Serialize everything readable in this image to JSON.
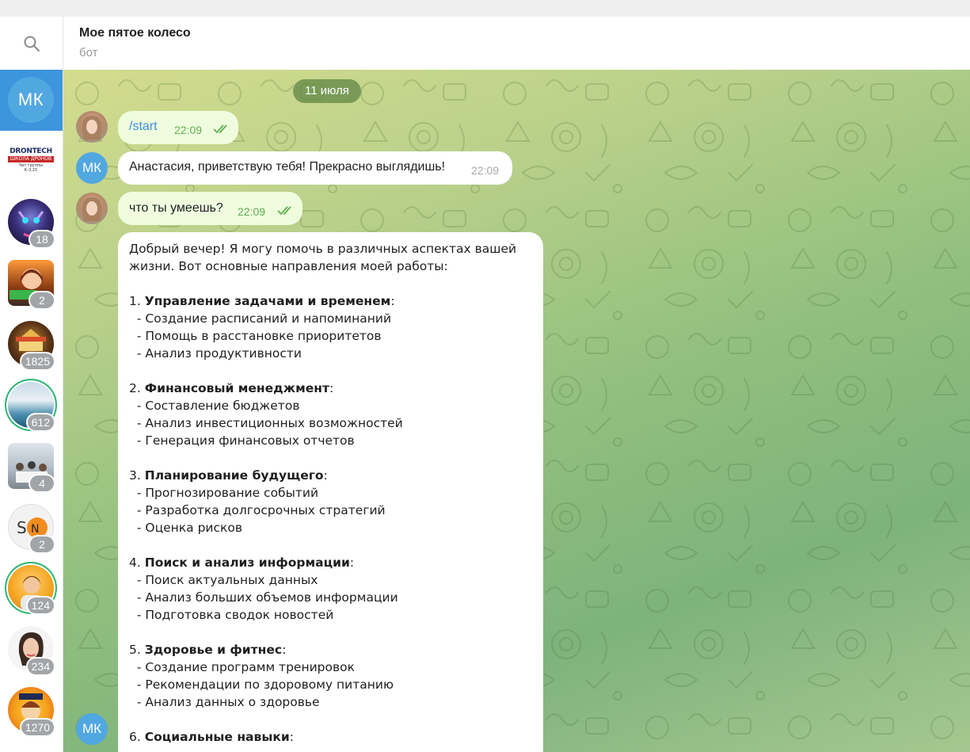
{
  "header": {
    "title": "Мое пятое колесо",
    "subtitle": "бот"
  },
  "sidebar": {
    "items": [
      {
        "initials": "МК",
        "active": true
      },
      {
        "logo_line1": "DRONTECH",
        "logo_line2": "ШКОЛА ДРОНОВ",
        "logo_line3": "Чат группы",
        "logo_line4": "К-3.15"
      },
      {
        "badge": "18"
      },
      {
        "badge": "2"
      },
      {
        "badge": "1825"
      },
      {
        "badge": "612"
      },
      {
        "badge": "4"
      },
      {
        "badge": "2"
      },
      {
        "badge": "124"
      },
      {
        "badge": "234"
      },
      {
        "badge": "1270"
      }
    ]
  },
  "chat": {
    "date": "11 июля",
    "avatar_initials": "МК",
    "messages": [
      {
        "text": "/start",
        "time": "22:09"
      },
      {
        "text": "Анастасия, приветствую тебя! Прекрасно выглядишь!",
        "time": "22:09"
      },
      {
        "text": "что ты умеешь?",
        "time": "22:09"
      }
    ],
    "reply": {
      "intro": "Добрый вечер! Я могу помочь в различных аспектах вашей\nжизни. Вот основные направления моей работы:",
      "sections": [
        {
          "num": "1. ",
          "title": "Управление задачами и временем",
          "items": [
            "Создание расписаний и напоминаний",
            "Помощь в расстановке приоритетов",
            "Анализ продуктивности"
          ]
        },
        {
          "num": "2. ",
          "title": "Финансовый менеджмент",
          "items": [
            "Составление бюджетов",
            "Анализ инвестиционных возможностей",
            "Генерация финансовых отчетов"
          ]
        },
        {
          "num": "3. ",
          "title": "Планирование будущего",
          "items": [
            "Прогнозирование событий",
            "Разработка долгосрочных стратегий",
            "Оценка рисков"
          ]
        },
        {
          "num": "4. ",
          "title": "Поиск и анализ информации",
          "items": [
            "Поиск актуальных данных",
            "Анализ больших объемов информации",
            "Подготовка сводок новостей"
          ]
        },
        {
          "num": "5. ",
          "title": "Здоровье и фитнес",
          "items": [
            "Создание программ тренировок",
            "Рекомендации по здоровому питанию",
            "Анализ данных о здоровье"
          ]
        },
        {
          "num": "6. ",
          "title": "Социальные навыки",
          "items": []
        }
      ]
    }
  },
  "colors": {
    "accent": "#3d95dd",
    "avatar_bg": "#51a7e0",
    "outgoing_bubble": "#effdde",
    "incoming_bubble": "#ffffff",
    "badge": "#a2a5a8",
    "ring": "#2bb673"
  },
  "icons": {
    "search": "search-icon",
    "read_receipt": "double-check-icon"
  }
}
